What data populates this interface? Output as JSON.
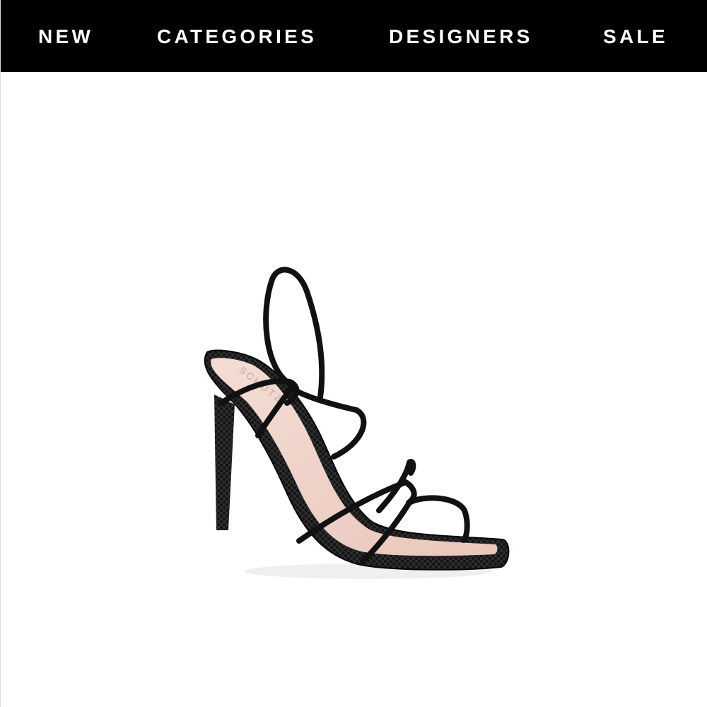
{
  "nav": {
    "items": [
      {
        "label": "NEW"
      },
      {
        "label": "CATEGORIES"
      },
      {
        "label": "DESIGNERS"
      },
      {
        "label": "SALE"
      }
    ]
  },
  "product": {
    "image": {
      "alt": "Black strappy square-toe heeled sandal",
      "icon": "product-photo"
    },
    "brand_stamp": "SCHUTZ"
  },
  "colors": {
    "nav_background": "#000000",
    "nav_text": "#ffffff",
    "page_background": "#ffffff",
    "sandal_black": "#111111",
    "insole_pink": "#efd1c8"
  }
}
